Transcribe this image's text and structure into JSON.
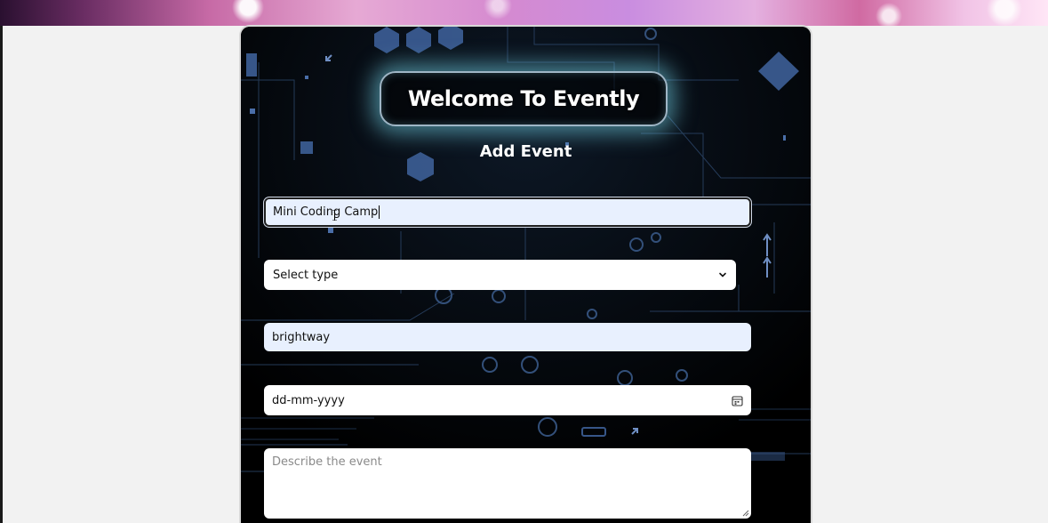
{
  "header": {
    "welcome_title": "Welcome To Evently",
    "subtitle": "Add Event"
  },
  "form": {
    "event_name": {
      "value": "Mini Coding Camp"
    },
    "event_type": {
      "selected": "Select type"
    },
    "venue": {
      "value": "brightway"
    },
    "date": {
      "placeholder": "dd-mm-yyyy"
    },
    "description": {
      "placeholder": "Describe the event"
    }
  },
  "colors": {
    "autofill_bg": "#e8f0fe",
    "card_bg": "#000000",
    "glow": "#78dcf0",
    "page_bg": "#f2f2f2"
  },
  "icons": {
    "select_arrow": "chevron-down-icon",
    "date_picker": "calendar-icon",
    "textarea_resize": "resize-handle-icon",
    "mouse_cursor": "text-cursor-icon"
  }
}
